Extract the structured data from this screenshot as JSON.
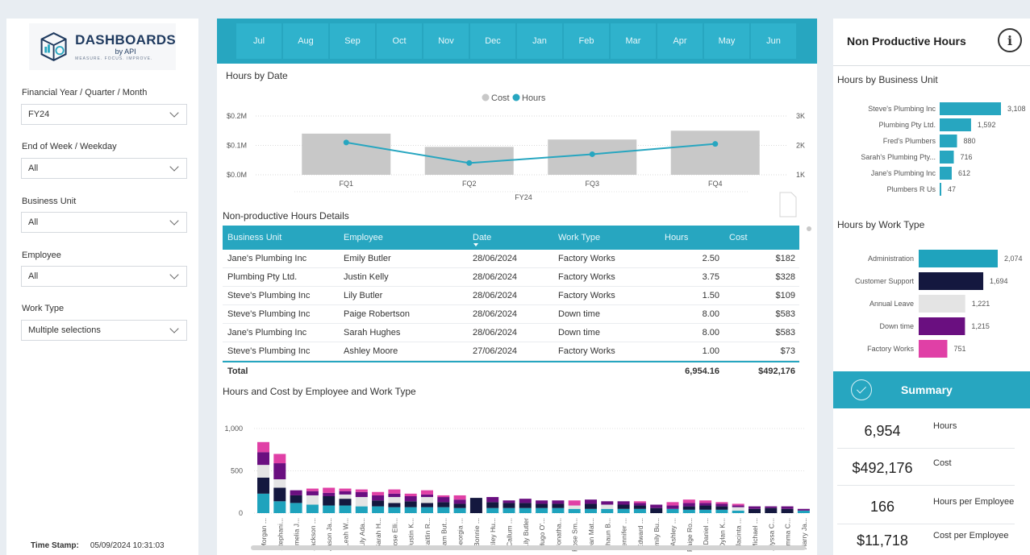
{
  "filters": {
    "logo_main": "DASHBOARDS",
    "logo_sub": "by API",
    "logo_tag": "MEASURE. FOCUS. IMPROVE.",
    "items": [
      {
        "label": "Financial Year / Quarter / Month",
        "value": "FY24"
      },
      {
        "label": "End of Week / Weekday",
        "value": "All"
      },
      {
        "label": "Business Unit",
        "value": "All"
      },
      {
        "label": "Employee",
        "value": "All"
      },
      {
        "label": "Work Type",
        "value": "Multiple selections"
      }
    ],
    "timestamp_label": "Time Stamp:",
    "timestamp_value": "05/09/2024 10:31:03"
  },
  "months": [
    "Jul",
    "Aug",
    "Sep",
    "Oct",
    "Nov",
    "Dec",
    "Jan",
    "Feb",
    "Mar",
    "Apr",
    "May",
    "Jun"
  ],
  "hours_by_date": {
    "title": "Hours by Date",
    "legend": [
      "Cost",
      "Hours"
    ]
  },
  "details": {
    "title": "Non-productive Hours Details",
    "columns": [
      "Business Unit",
      "Employee",
      "Date",
      "Work Type",
      "Hours",
      "Cost"
    ],
    "rows": [
      [
        "Jane's Plumbing Inc",
        "Emily Butler",
        "28/06/2024",
        "Factory Works",
        "2.50",
        "$182"
      ],
      [
        "Plumbing Pty Ltd.",
        "Justin Kelly",
        "28/06/2024",
        "Factory Works",
        "3.75",
        "$328"
      ],
      [
        "Steve's Plumbing Inc",
        "Lily Butler",
        "28/06/2024",
        "Factory Works",
        "1.50",
        "$109"
      ],
      [
        "Steve's Plumbing Inc",
        "Paige Robertson",
        "28/06/2024",
        "Down time",
        "8.00",
        "$583"
      ],
      [
        "Jane's Plumbing Inc",
        "Sarah Hughes",
        "28/06/2024",
        "Down time",
        "8.00",
        "$583"
      ],
      [
        "Steve's Plumbing Inc",
        "Ashley Moore",
        "27/06/2024",
        "Factory Works",
        "1.00",
        "$73"
      ]
    ],
    "total_label": "Total",
    "total_hours": "6,954.16",
    "total_cost": "$492,176"
  },
  "employee_chart_title": "Hours and Cost by Employee and Work Type",
  "right": {
    "title": "Non Productive Hours",
    "info_glyph": "i",
    "bu_title": "Hours by Business Unit",
    "wt_title": "Hours by Work Type",
    "summary_title": "Summary",
    "summary": [
      {
        "value": "6,954",
        "label": "Hours"
      },
      {
        "value": "$492,176",
        "label": "Cost"
      },
      {
        "value": "166",
        "label": "Hours per Employee"
      },
      {
        "value": "$11,718",
        "label": "Cost per Employee"
      }
    ]
  },
  "colors": {
    "accent": "#27a6c0",
    "cost_bar": "#c8c8c8",
    "administration": "#1fa3bd",
    "customer_support": "#14183f",
    "annual_leave": "#e4e4e4",
    "down_time": "#6a0f80",
    "factory_works": "#e040a6"
  },
  "chart_data": [
    {
      "type": "bar+line",
      "title": "Hours by Date",
      "categories": [
        "FQ1",
        "FQ2",
        "FQ3",
        "FQ4"
      ],
      "group_label": "FY24",
      "series": [
        {
          "name": "Cost",
          "type": "bar",
          "axis": "left",
          "values": [
            0.14,
            0.095,
            0.12,
            0.15
          ]
        },
        {
          "name": "Hours",
          "type": "line",
          "axis": "right",
          "values": [
            2.1,
            1.4,
            1.7,
            2.05
          ]
        }
      ],
      "y_left_ticks": [
        "$0.0M",
        "$0.1M",
        "$0.2M"
      ],
      "y_left_range": [
        0,
        0.2
      ],
      "y_right_ticks": [
        "1K",
        "2K",
        "3K"
      ],
      "y_right_range": [
        1,
        3
      ]
    },
    {
      "type": "bar",
      "title": "Hours by Business Unit",
      "categories": [
        "Steve's Plumbing Inc",
        "Plumbing Pty Ltd.",
        "Fred's Plumbers",
        "Sarah's Plumbing Pty...",
        "Jane's Plumbing Inc",
        "Plumbers R Us"
      ],
      "values": [
        3108,
        1592,
        880,
        716,
        612,
        47
      ],
      "labels": [
        "3,108",
        "1,592",
        "880",
        "716",
        "612",
        "47"
      ]
    },
    {
      "type": "bar",
      "title": "Hours by Work Type",
      "categories": [
        "Administration",
        "Customer Support",
        "Annual Leave",
        "Down time",
        "Factory Works"
      ],
      "values": [
        2074,
        1694,
        1221,
        1215,
        751
      ],
      "labels": [
        "2,074",
        "1,694",
        "1,221",
        "1,215",
        "751"
      ]
    },
    {
      "type": "stacked-bar",
      "title": "Hours and Cost by Employee and Work Type",
      "y_ticks": [
        "0",
        "500",
        "1,000"
      ],
      "y_range": [
        0,
        1000
      ],
      "categories": [
        "Morgan ...",
        "Stephani...",
        "Amelia J...",
        "Jackson ...",
        "Jason Ja...",
        "Leah W...",
        "Lily Ada...",
        "Sarah H...",
        "Rose Elli...",
        "Justin K...",
        "Caitlin R...",
        "Sam But...",
        "Georgia ...",
        "Bonnie ...",
        "Riley Hu...",
        "Callum ...",
        "Lily Butler",
        "Hugo O'...",
        "Jonatha...",
        "Rose Sm...",
        "Dan Mat...",
        "Shaun B...",
        "Jennifer ...",
        "Edward ...",
        "Emily Bu...",
        "Ashley ...",
        "Paige Ro...",
        "Daniel ...",
        "Dylan K...",
        "Jacinta ...",
        "Michael ...",
        "Alyssa C...",
        "Emma C...",
        "Harry Ja..."
      ],
      "series": [
        {
          "name": "Administration",
          "values": [
            230,
            140,
            120,
            100,
            90,
            90,
            80,
            80,
            70,
            70,
            70,
            70,
            60,
            0,
            60,
            60,
            60,
            60,
            60,
            50,
            50,
            50,
            50,
            50,
            0,
            50,
            40,
            40,
            40,
            30,
            0,
            0,
            0,
            30
          ]
        },
        {
          "name": "Customer Support",
          "values": [
            190,
            160,
            90,
            0,
            110,
            80,
            0,
            70,
            50,
            70,
            50,
            60,
            50,
            180,
            70,
            60,
            60,
            50,
            50,
            0,
            60,
            0,
            50,
            40,
            60,
            0,
            40,
            50,
            40,
            0,
            50,
            60,
            50,
            0
          ]
        },
        {
          "name": "Annual Leave",
          "values": [
            150,
            100,
            0,
            110,
            0,
            50,
            110,
            0,
            70,
            0,
            70,
            0,
            0,
            0,
            0,
            0,
            0,
            0,
            0,
            40,
            0,
            50,
            0,
            0,
            0,
            0,
            0,
            0,
            0,
            40,
            0,
            0,
            0,
            0
          ]
        },
        {
          "name": "Down time",
          "values": [
            150,
            190,
            60,
            50,
            40,
            40,
            60,
            60,
            40,
            60,
            30,
            60,
            50,
            0,
            60,
            30,
            50,
            40,
            40,
            0,
            50,
            40,
            40,
            30,
            40,
            40,
            40,
            30,
            30,
            20,
            30,
            20,
            30,
            20
          ]
        },
        {
          "name": "Factory Works",
          "values": [
            120,
            110,
            0,
            30,
            60,
            30,
            30,
            40,
            50,
            30,
            50,
            20,
            50,
            0,
            0,
            0,
            0,
            0,
            0,
            60,
            0,
            0,
            0,
            20,
            0,
            40,
            40,
            30,
            20,
            20,
            0,
            0,
            0,
            0
          ]
        }
      ]
    }
  ]
}
